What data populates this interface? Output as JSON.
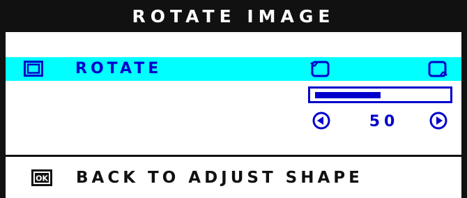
{
  "menu": {
    "title": "ROTATE IMAGE",
    "rotate_label": "ROTATE",
    "rotation_value": "50",
    "rotation_level": 0.5,
    "back_label": "BACK TO ADJUST SHAPE"
  },
  "icons": {
    "row": "rotate-screen-icon",
    "ccw": "rotate-counterclockwise-icon",
    "cw": "rotate-clockwise-icon",
    "left": "arrow-left-icon",
    "right": "arrow-right-icon",
    "ok": "ok-button-icon"
  },
  "colors": {
    "highlight": "#00ffff",
    "accent": "#0000cc",
    "frame": "#111111"
  }
}
